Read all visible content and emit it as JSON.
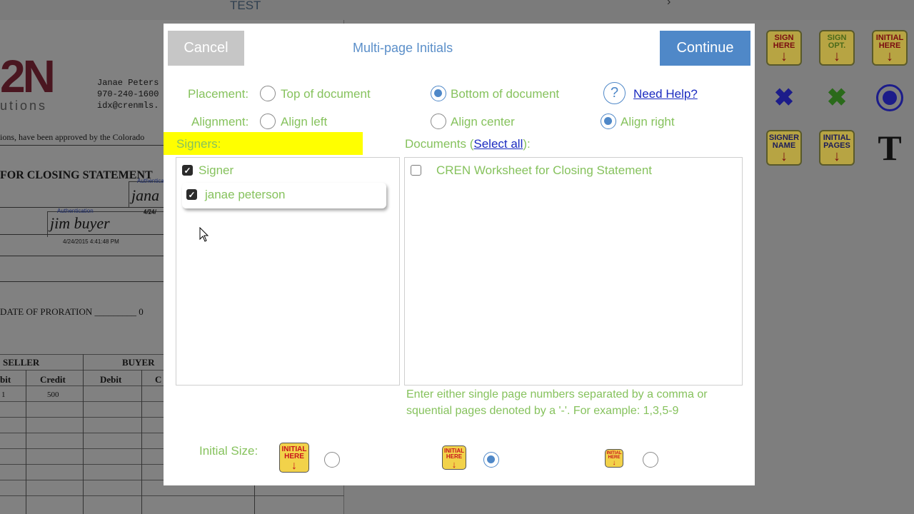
{
  "background": {
    "top_label": "TEST",
    "logo_text": "2N",
    "logo_sub": "utions",
    "contact_lines": [
      "Janae Peters",
      "970-240-1600",
      "idx@crenmls."
    ],
    "approved_text": "ions, have been approved by the Colorado",
    "heading": "FOR CLOSING STATEMENT",
    "auth_label": "Authentication",
    "sig_top": "jana",
    "sig_top_date": "4/24/",
    "sig_buyer": "jim buyer",
    "sig_buyer_date": "4/24/",
    "sig_timestamp": "4/24/2015 4:41:48 PM",
    "proration": "DATE OF PRORATION _________ 0",
    "table": {
      "seller": "SELLER",
      "buyer": "BUYER",
      "col_bit": "bit",
      "col_credit": "Credit",
      "col_debit": "Debit",
      "col_c": "C",
      "row1_a": "1",
      "row1_b": "500"
    },
    "tools": [
      {
        "label": "SIGN HERE",
        "color": "#c8141c"
      },
      {
        "label": "SIGN OPT.",
        "color": "#5a8a2a"
      },
      {
        "label": "INITIAL HERE",
        "color": "#c8141c"
      },
      {
        "label": "SIGNER NAME",
        "color": "#c8141c"
      },
      {
        "label": "INITIAL PAGES",
        "color": "#c8141c"
      }
    ],
    "tool_symbols": {
      "x_blue": "✖",
      "x_green": "✖",
      "text": "T"
    }
  },
  "modal": {
    "cancel_label": "Cancel",
    "title": "Multi-page Initials",
    "continue_label": "Continue",
    "placement": {
      "label": "Placement:",
      "options": [
        "Top of document",
        "Bottom of document"
      ],
      "selected": "Bottom of document"
    },
    "alignment": {
      "label": "Alignment:",
      "options": [
        "Align left",
        "Align center",
        "Align right"
      ],
      "selected": "Align right"
    },
    "help": {
      "icon": "?",
      "label": "Need Help?"
    },
    "signers": {
      "label": "Signers:",
      "group": "Signer",
      "items": [
        "janae peterson"
      ]
    },
    "documents": {
      "label_prefix": "Documents (",
      "select_all": "Select all",
      "label_suffix": "):",
      "items": [
        "CREN Worksheet for Closing Statement"
      ]
    },
    "pages_help": "Enter either single page numbers separated by a comma or squential pages denoted by a '-'. For example: 1,3,5-9",
    "initial_size": {
      "label": "Initial Size:",
      "icon_text": "INITIAL HERE",
      "selected": "medium"
    }
  },
  "colors": {
    "accent": "#4f88c8",
    "label_green": "#86c25d",
    "highlight": "#ffff00",
    "link": "#1a2ac0"
  }
}
